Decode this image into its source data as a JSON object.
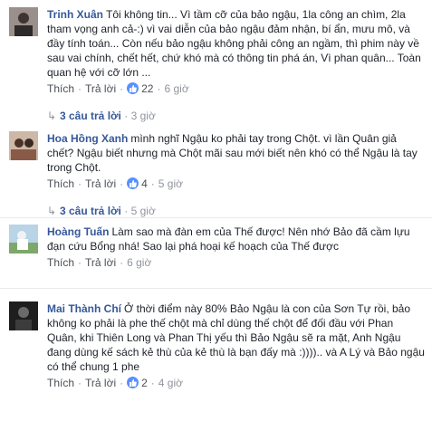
{
  "comments": [
    {
      "author": "Trinh Xuân",
      "text": "Tôi không tin... Vì tầm cỡ của bảo ngậu, 1la công an chìm, 2la tham vọng anh cả-:) vì vai diễn của bảo ngậu đảm nhận, bí ẩn, mưu mô, và đầy tính toán... Còn nếu bảo ngậu không phải công an ngầm, thì phim này về sau vai chính, chết hết, chứ khó mà có thông tin phá án, Vì phan quân... Toàn quan hệ với cỡ lớn ...",
      "like_label": "Thích",
      "reply_label": "Trả lời",
      "likes": "22",
      "time": "6 giờ",
      "replies_label": "3 câu trả lời",
      "replies_time": "3 giờ",
      "avatar_color": "#6d6a70"
    },
    {
      "author": "Hoa Hồng Xanh",
      "text": "mình nghĩ Ngậu ko phải tay trong Chột. vì lần Quân giả chết? Ngậu biết nhưng mà Chột mãi sau mới biết nên khó có thể Ngậu là tay trong Chột.",
      "like_label": "Thích",
      "reply_label": "Trả lời",
      "likes": "4",
      "time": "5 giờ",
      "replies_label": "3 câu trả lời",
      "replies_time": "5 giờ",
      "avatar_color": "#7a5a4e"
    },
    {
      "author": "Hoàng Tuấn",
      "text": "Làm sao mà đàn em của Thế được! Nên nhớ Bảo đã cầm lựu đạn cứu Bổng nhá! Sao lại phá hoại kế hoạch của Thế được",
      "like_label": "Thích",
      "reply_label": "Trả lời",
      "likes": "",
      "time": "6 giờ",
      "replies_label": "",
      "replies_time": "",
      "avatar_color": "#8fb0c8"
    },
    {
      "author": "Mai Thành Chí",
      "text": "Ở thời điểm này 80% Bảo Ngậu là con của Sơn Tự rồi, bảo không ko phải là phe thế chột mà chỉ dùng thế chột để đối đầu với Phan Quân, khi Thiên Long và Phan Thị yếu thì Bảo Ngậu sẽ ra mặt, Anh Ngậu đang dùng kế sách kẻ thù của kẻ thù là bạn đấy mà :)))).. và A Lý và Bảo ngậu có thể chung 1 phe",
      "like_label": "Thích",
      "reply_label": "Trả lời",
      "likes": "2",
      "time": "4 giờ",
      "replies_label": "",
      "replies_time": "",
      "avatar_color": "#2f2f2f"
    }
  ],
  "colors": {
    "link": "#365899",
    "meta": "#90949c",
    "like": "#5890ff"
  },
  "icons": {
    "like": "thumbs-up-icon",
    "reply_arrow": "reply-arrow-icon"
  }
}
